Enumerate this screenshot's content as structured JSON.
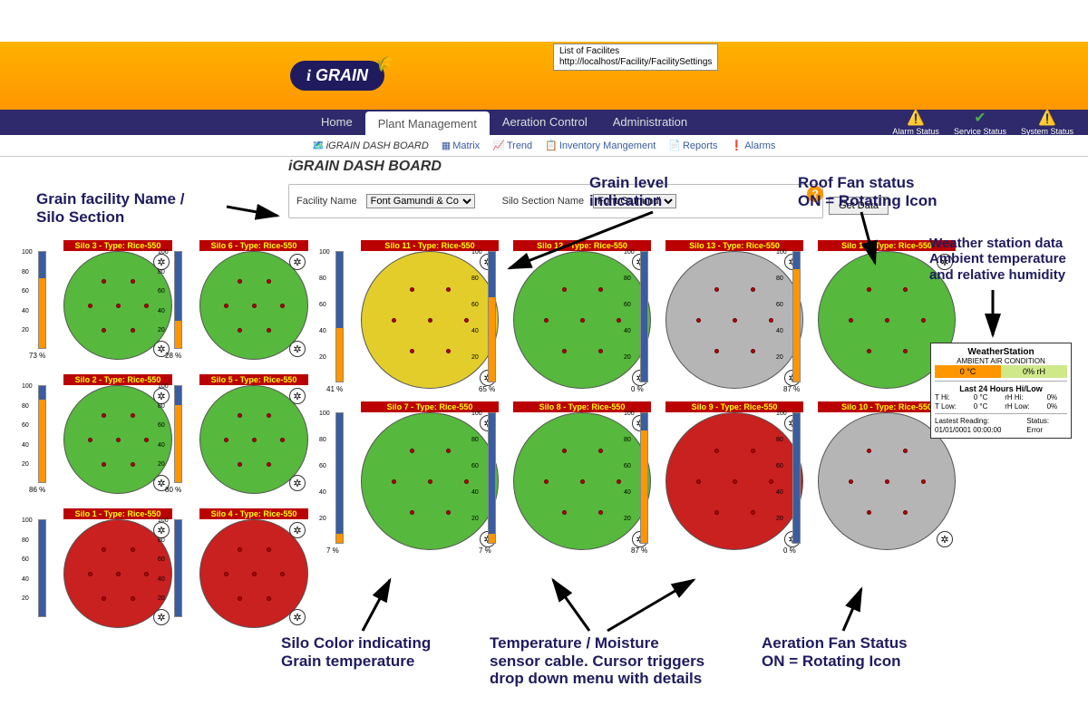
{
  "tooltip": {
    "line1": "List of Facilites",
    "line2": "http://localhost/Facility/FacilitySettings"
  },
  "logo": {
    "prefix": "i",
    "word": "GRAIN"
  },
  "nav": {
    "home": "Home",
    "plant": "Plant Management",
    "aeration": "Aeration Control",
    "admin": "Administration"
  },
  "status": {
    "alarm": "Alarm Status",
    "service": "Service Status",
    "system": "System Status"
  },
  "subnav": {
    "dash": "iGRAIN DASH BOARD",
    "matrix": "Matrix",
    "trend": "Trend",
    "inventory": "Inventory Mangement",
    "reports": "Reports",
    "alarms": "Alarms"
  },
  "dash_title": "iGRAIN DASH BOARD",
  "filters": {
    "facility_label": "Facility Name",
    "facility_value": "Font Gamundi & Co",
    "section_label": "Silo Section Name",
    "section_value": "Font Gamundi",
    "get_data": "Get Data"
  },
  "silos": {
    "s3": {
      "title": "Silo 3 - Type: Rice-550",
      "pct": "73 %",
      "color": "green"
    },
    "s6": {
      "title": "Silo 6 - Type: Rice-550",
      "pct": "28 %",
      "color": "green"
    },
    "s11": {
      "title": "Silo 11 - Type: Rice-550",
      "pct": "41 %",
      "color": "yellow"
    },
    "s12": {
      "title": "Silo 12 - Type: Rice-550",
      "pct": "65 %",
      "color": "green"
    },
    "s13": {
      "title": "Silo 13 - Type: Rice-550",
      "pct": "0 %",
      "color": "grey"
    },
    "s14": {
      "title": "Silo 14 - Type: Rice-550",
      "pct": "87 %",
      "color": "green"
    },
    "s2": {
      "title": "Silo 2 - Type: Rice-550",
      "pct": "86 %",
      "color": "green"
    },
    "s5": {
      "title": "Silo 5 - Type: Rice-550",
      "pct": "80 %",
      "color": "green"
    },
    "s7": {
      "title": "Silo 7 - Type: Rice-550",
      "pct": "7 %",
      "color": "green"
    },
    "s8": {
      "title": "Silo 8 - Type: Rice-550",
      "pct": "7 %",
      "color": "green"
    },
    "s9": {
      "title": "Silo 9 - Type: Rice-550",
      "pct": "87 %",
      "color": "red"
    },
    "s10": {
      "title": "Silo 10 - Type: Rice-550",
      "pct": "0 %",
      "color": "grey"
    },
    "s1": {
      "title": "Silo 1 - Type: Rice-550",
      "pct": "",
      "color": "red"
    },
    "s4": {
      "title": "Silo 4 - Type: Rice-550",
      "pct": "",
      "color": "red"
    }
  },
  "weather": {
    "title": "WeatherStation",
    "sub": "AMBIENT AIR CONDITION",
    "temp": "0 °C",
    "hum": "0% rH",
    "lasthead": "Last 24 Hours Hi/Low",
    "thi_l": "T Hi:",
    "thi_v": "0 °C",
    "rh_hi_l": "rH Hi:",
    "rh_hi_v": "0%",
    "tlo_l": "T Low:",
    "tlo_v": "0 °C",
    "rh_lo_l": "rH Low:",
    "rh_lo_v": "0%",
    "lastread_l": "Lastest Reading:",
    "status_l": "Status:",
    "lastread_v": "01/01/0001 00:00:00",
    "status_v": "Error"
  },
  "annotations": {
    "facility": "Grain facility Name /\nSilo Section",
    "level": "Grain level\nindication",
    "roof": "Roof Fan status\nON = Rotating Icon",
    "weather": "Weather station data\nAmbient temperature\nand relative humidity",
    "color": "Silo Color indicating\nGrain temperature",
    "sensor": "Temperature / Moisture\nsensor cable. Cursor triggers\ndrop down menu with details",
    "aeration": "Aeration Fan Status\nON = Rotating Icon"
  }
}
